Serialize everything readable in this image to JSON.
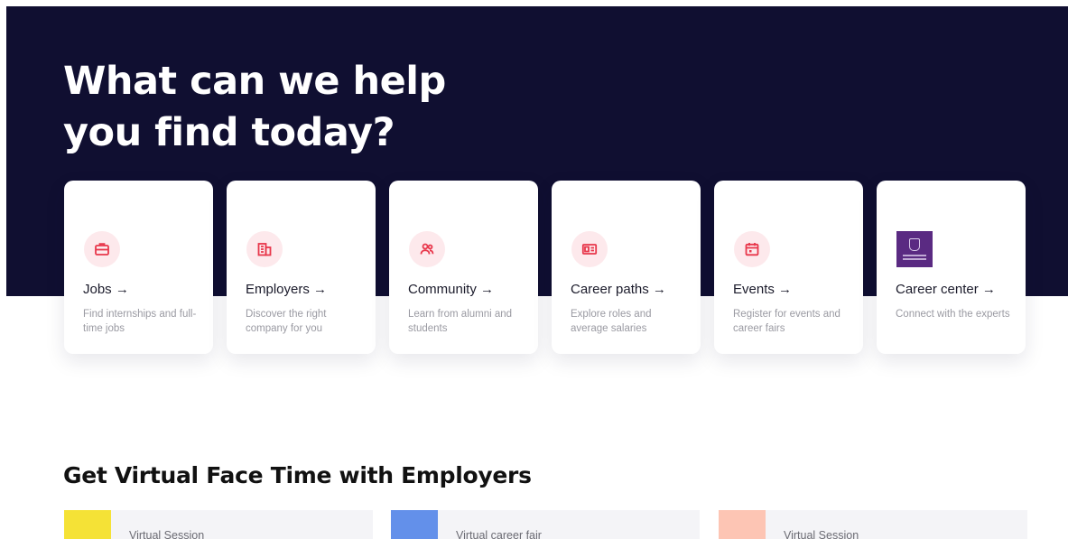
{
  "hero": {
    "title_line1": "What can we help",
    "title_line2": "you find today?",
    "background_color": "#100f31"
  },
  "cards": [
    {
      "title": "Jobs →",
      "description": "Find internships and full-time jobs",
      "icon": "briefcase-icon"
    },
    {
      "title": "Employers →",
      "description": "Discover the right company for you",
      "icon": "building-icon"
    },
    {
      "title": "Community →",
      "description": "Learn from alumni and students",
      "icon": "people-icon"
    },
    {
      "title": "Career paths →",
      "description": "Explore roles and average salaries",
      "icon": "id-card-icon"
    },
    {
      "title": "Events →",
      "description": "Register for events and career fairs",
      "icon": "calendar-icon"
    },
    {
      "title": "Career center →",
      "description": "Connect with the experts",
      "icon": "school-logo"
    }
  ],
  "accent_color": "#e8374b",
  "section": {
    "title": "Get Virtual Face Time with Employers"
  },
  "sessions": [
    {
      "tag": "Virtual Session",
      "color": "#f5e236"
    },
    {
      "tag": "Virtual career fair",
      "color": "#6390ea"
    },
    {
      "tag": "Virtual Session",
      "color": "#fdc5b4"
    }
  ]
}
